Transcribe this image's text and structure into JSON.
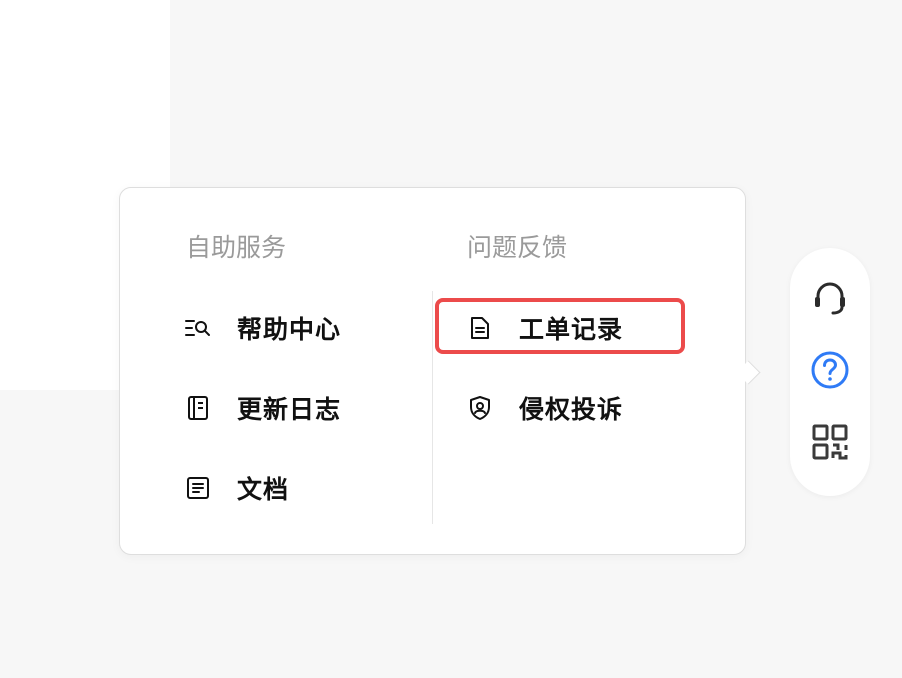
{
  "self_service": {
    "title": "自助服务",
    "items": [
      {
        "label": "帮助中心",
        "icon": "search-list-icon"
      },
      {
        "label": "更新日志",
        "icon": "notebook-icon"
      },
      {
        "label": "文档",
        "icon": "document-icon"
      }
    ]
  },
  "feedback": {
    "title": "问题反馈",
    "items": [
      {
        "label": "工单记录",
        "icon": "file-text-icon"
      },
      {
        "label": "侵权投诉",
        "icon": "shield-user-icon"
      }
    ]
  },
  "side_toolbar": {
    "buttons": [
      "headset-icon",
      "help-circle-icon",
      "qr-code-icon"
    ]
  },
  "colors": {
    "highlight": "#ec4b4b",
    "accent": "#2f7bf6",
    "muted_title": "#9a9a9a"
  }
}
